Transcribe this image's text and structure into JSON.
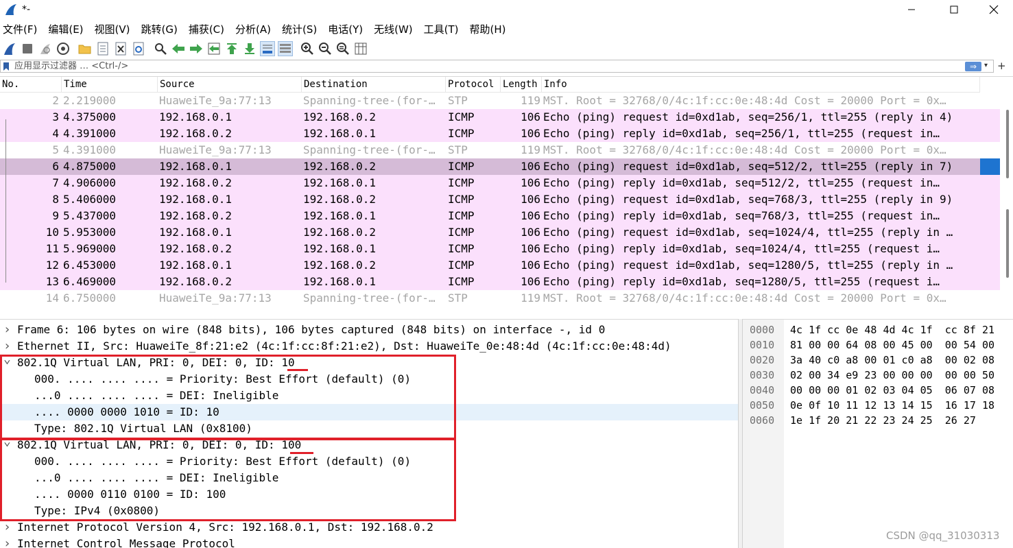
{
  "window": {
    "title": "*-",
    "controls": {
      "minimize": "—",
      "maximize": "☐",
      "close": "✕"
    }
  },
  "menu": [
    "文件(F)",
    "编辑(E)",
    "视图(V)",
    "跳转(G)",
    "捕获(C)",
    "分析(A)",
    "统计(S)",
    "电话(Y)",
    "无线(W)",
    "工具(T)",
    "帮助(H)"
  ],
  "toolbar_icons": [
    "shark-fin-start-icon",
    "stop-capture-icon",
    "restart-capture-icon",
    "capture-options-icon",
    "open-file-icon",
    "save-file-icon",
    "close-file-icon",
    "reload-file-icon",
    "find-packet-icon",
    "go-back-icon",
    "go-forward-icon",
    "go-to-packet-icon",
    "go-first-icon",
    "go-last-icon",
    "autoscroll-icon",
    "colorize-icon",
    "zoom-in-icon",
    "zoom-out-icon",
    "zoom-normal-icon",
    "resize-columns-icon"
  ],
  "filter": {
    "placeholder": "应用显示过滤器 … <Ctrl-/>",
    "apply_label": "⇒"
  },
  "packet_list": {
    "columns": [
      "No.",
      "Time",
      "Source",
      "Destination",
      "Protocol",
      "Length",
      "Info"
    ],
    "rows": [
      {
        "no": "2",
        "time": "2.219000",
        "src": "HuaweiTe_9a:77:13",
        "dst": "Spanning-tree-(for-…",
        "proto": "STP",
        "len": "119",
        "info": "MST. Root = 32768/0/4c:1f:cc:0e:48:4d  Cost = 20000  Port = 0x…",
        "kind": "stp"
      },
      {
        "no": "3",
        "time": "4.375000",
        "src": "192.168.0.1",
        "dst": "192.168.0.2",
        "proto": "ICMP",
        "len": "106",
        "info": "Echo (ping) request  id=0xd1ab, seq=256/1, ttl=255 (reply in 4)",
        "kind": "icmp"
      },
      {
        "no": "4",
        "time": "4.391000",
        "src": "192.168.0.2",
        "dst": "192.168.0.1",
        "proto": "ICMP",
        "len": "106",
        "info": "Echo (ping) reply    id=0xd1ab, seq=256/1, ttl=255 (request in…",
        "kind": "icmp"
      },
      {
        "no": "5",
        "time": "4.391000",
        "src": "HuaweiTe_9a:77:13",
        "dst": "Spanning-tree-(for-…",
        "proto": "STP",
        "len": "119",
        "info": "MST. Root = 32768/0/4c:1f:cc:0e:48:4d  Cost = 20000  Port = 0x…",
        "kind": "stp"
      },
      {
        "no": "6",
        "time": "4.875000",
        "src": "192.168.0.1",
        "dst": "192.168.0.2",
        "proto": "ICMP",
        "len": "106",
        "info": "Echo (ping) request  id=0xd1ab, seq=512/2, ttl=255 (reply in 7)",
        "kind": "sel"
      },
      {
        "no": "7",
        "time": "4.906000",
        "src": "192.168.0.2",
        "dst": "192.168.0.1",
        "proto": "ICMP",
        "len": "106",
        "info": "Echo (ping) reply    id=0xd1ab, seq=512/2, ttl=255 (request in…",
        "kind": "icmp"
      },
      {
        "no": "8",
        "time": "5.406000",
        "src": "192.168.0.1",
        "dst": "192.168.0.2",
        "proto": "ICMP",
        "len": "106",
        "info": "Echo (ping) request  id=0xd1ab, seq=768/3, ttl=255 (reply in 9)",
        "kind": "icmp"
      },
      {
        "no": "9",
        "time": "5.437000",
        "src": "192.168.0.2",
        "dst": "192.168.0.1",
        "proto": "ICMP",
        "len": "106",
        "info": "Echo (ping) reply    id=0xd1ab, seq=768/3, ttl=255 (request in…",
        "kind": "icmp"
      },
      {
        "no": "10",
        "time": "5.953000",
        "src": "192.168.0.1",
        "dst": "192.168.0.2",
        "proto": "ICMP",
        "len": "106",
        "info": "Echo (ping) request  id=0xd1ab, seq=1024/4, ttl=255 (reply in …",
        "kind": "icmp"
      },
      {
        "no": "11",
        "time": "5.969000",
        "src": "192.168.0.2",
        "dst": "192.168.0.1",
        "proto": "ICMP",
        "len": "106",
        "info": "Echo (ping) reply    id=0xd1ab, seq=1024/4, ttl=255 (request i…",
        "kind": "icmp"
      },
      {
        "no": "12",
        "time": "6.453000",
        "src": "192.168.0.1",
        "dst": "192.168.0.2",
        "proto": "ICMP",
        "len": "106",
        "info": "Echo (ping) request  id=0xd1ab, seq=1280/5, ttl=255 (reply in …",
        "kind": "icmp"
      },
      {
        "no": "13",
        "time": "6.469000",
        "src": "192.168.0.2",
        "dst": "192.168.0.1",
        "proto": "ICMP",
        "len": "106",
        "info": "Echo (ping) reply    id=0xd1ab, seq=1280/5, ttl=255 (request i…",
        "kind": "icmp"
      },
      {
        "no": "14",
        "time": "6.750000",
        "src": "HuaweiTe_9a:77:13",
        "dst": "Spanning-tree-(for-…",
        "proto": "STP",
        "len": "119",
        "info": "MST. Root = 32768/0/4c:1f:cc:0e:48:4d  Cost = 20000  Port = 0x…",
        "kind": "stp"
      }
    ]
  },
  "details": [
    {
      "arrow": ">",
      "indent": 0,
      "text": "Frame 6: 106 bytes on wire (848 bits), 106 bytes captured (848 bits) on interface -, id 0"
    },
    {
      "arrow": ">",
      "indent": 0,
      "text": "Ethernet II, Src: HuaweiTe_8f:21:e2 (4c:1f:cc:8f:21:e2), Dst: HuaweiTe_0e:48:4d (4c:1f:cc:0e:48:4d)"
    },
    {
      "arrow": "v",
      "indent": 0,
      "text": "802.1Q Virtual LAN, PRI: 0, DEI: 0, ID: 10"
    },
    {
      "arrow": "",
      "indent": 1,
      "text": "000. .... .... .... = Priority: Best Effort (default) (0)"
    },
    {
      "arrow": "",
      "indent": 1,
      "text": "...0 .... .... .... = DEI: Ineligible"
    },
    {
      "arrow": "",
      "indent": 1,
      "text": ".... 0000 0000 1010 = ID: 10",
      "highlight": true
    },
    {
      "arrow": "",
      "indent": 1,
      "text": "Type: 802.1Q Virtual LAN (0x8100)"
    },
    {
      "arrow": "v",
      "indent": 0,
      "text": "802.1Q Virtual LAN, PRI: 0, DEI: 0, ID: 100"
    },
    {
      "arrow": "",
      "indent": 1,
      "text": "000. .... .... .... = Priority: Best Effort (default) (0)"
    },
    {
      "arrow": "",
      "indent": 1,
      "text": "...0 .... .... .... = DEI: Ineligible"
    },
    {
      "arrow": "",
      "indent": 1,
      "text": ".... 0000 0110 0100 = ID: 100"
    },
    {
      "arrow": "",
      "indent": 1,
      "text": "Type: IPv4 (0x0800)"
    },
    {
      "arrow": ">",
      "indent": 0,
      "text": "Internet Protocol Version 4, Src: 192.168.0.1, Dst: 192.168.0.2"
    },
    {
      "arrow": ">",
      "indent": 0,
      "text": "Internet Control Message Protocol"
    }
  ],
  "hex": [
    {
      "offset": "0000",
      "bytes": "4c 1f cc 0e 48 4d 4c 1f  cc 8f 21"
    },
    {
      "offset": "0010",
      "bytes": "81 00 00 64 08 00 45 00  00 54 00"
    },
    {
      "offset": "0020",
      "bytes": "3a 40 c0 a8 00 01 c0 a8  00 02 08"
    },
    {
      "offset": "0030",
      "bytes": "02 00 34 e9 23 00 00 00  00 00 50"
    },
    {
      "offset": "0040",
      "bytes": "00 00 00 01 02 03 04 05  06 07 08"
    },
    {
      "offset": "0050",
      "bytes": "0e 0f 10 11 12 13 14 15  16 17 18"
    },
    {
      "offset": "0060",
      "bytes": "1e 1f 20 21 22 23 24 25  26 27"
    }
  ],
  "watermark": "CSDN @qq_31030313",
  "colors": {
    "icmp_row": "#fbe0fc",
    "selected_row": "#d5bbd7",
    "stp_text": "#a6a6a6",
    "annotation_red": "#e0202a",
    "highlight_detail": "#e5f1fb"
  }
}
